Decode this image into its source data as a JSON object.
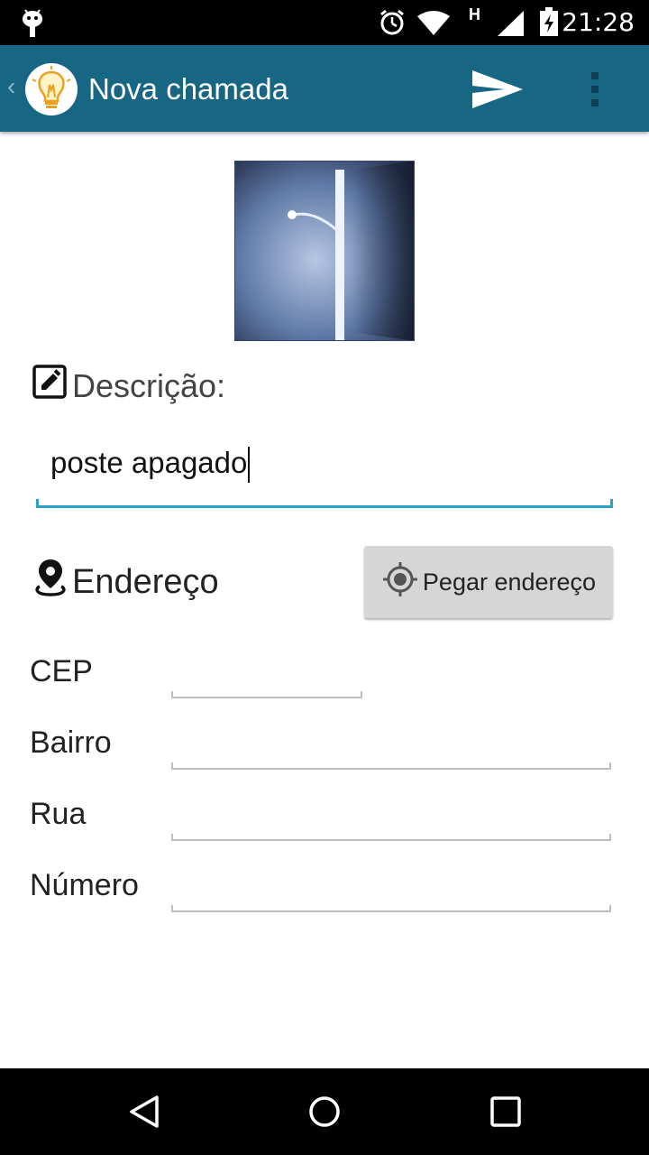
{
  "status_bar": {
    "time": "21:28",
    "network_label": "H",
    "icons": [
      "android-icon",
      "alarm-icon",
      "wifi-icon",
      "signal-icon",
      "battery-charging-icon"
    ]
  },
  "app_bar": {
    "title": "Nova chamada",
    "icons": [
      "back-chevron-icon",
      "lightbulb-logo-icon",
      "send-icon",
      "overflow-menu-icon"
    ],
    "accent_color": "#176683"
  },
  "photo": {
    "description_icon": "photo-thumbnail"
  },
  "description": {
    "label": "Descrição:",
    "value": "poste apagado",
    "icon": "edit-icon",
    "focus_color": "#2aa3cc"
  },
  "address": {
    "label": "Endereço",
    "icon": "location-pin-icon",
    "button_label": "Pegar endereço",
    "button_icon": "gps-target-icon"
  },
  "fields": [
    {
      "label": "CEP",
      "value": ""
    },
    {
      "label": "Bairro",
      "value": ""
    },
    {
      "label": "Rua",
      "value": ""
    },
    {
      "label": "Número",
      "value": ""
    }
  ],
  "nav_bar": {
    "icons": [
      "back-triangle-icon",
      "home-circle-icon",
      "recents-square-icon"
    ]
  }
}
